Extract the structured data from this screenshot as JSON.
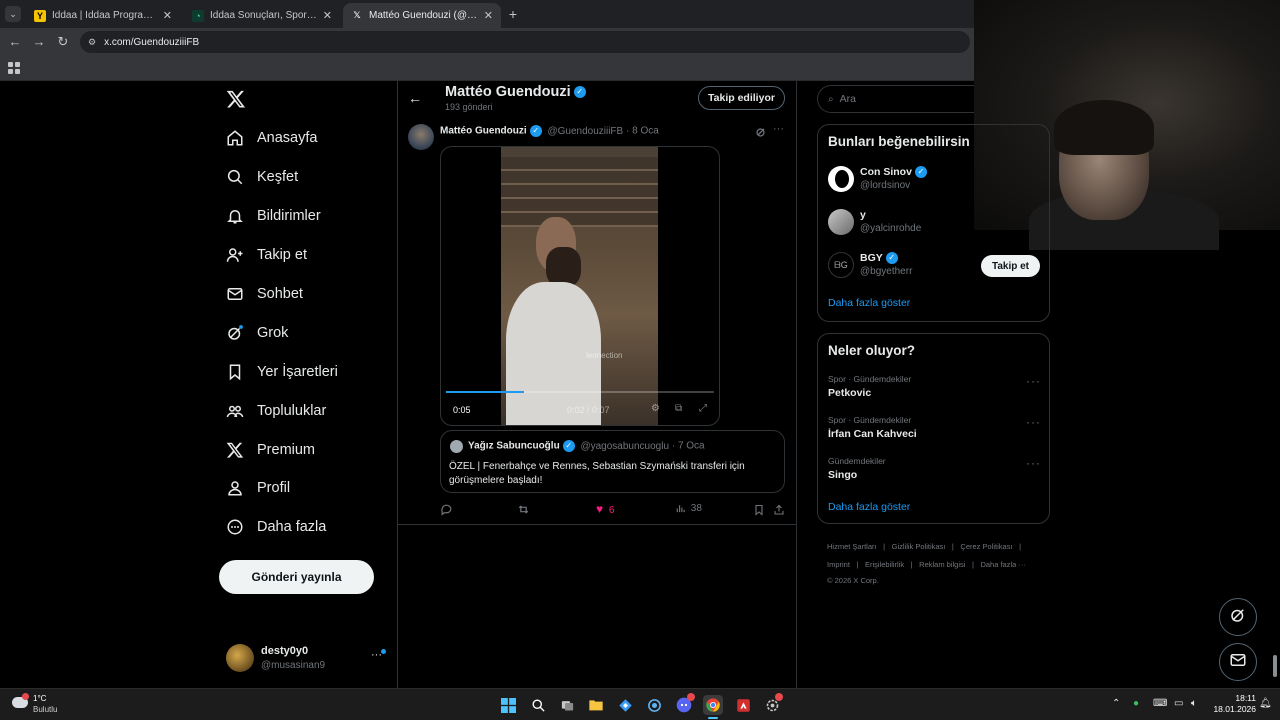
{
  "browser": {
    "tabs": [
      {
        "title": "İddaa | İddaa Programı | Canlı İ",
        "icon": "iddaa-favicon",
        "active": false
      },
      {
        "title": "İddaa Sonuçları, Spor Toto Süpe",
        "icon": "sonuclar-favicon",
        "active": false
      },
      {
        "title": "Mattéo Guendouzi (@Guen",
        "icon": "x-favicon",
        "active": true
      }
    ],
    "url": "x.com/GuendouziiiFB"
  },
  "sidebar": {
    "items": [
      {
        "label": "Anasayfa",
        "icon": "home-icon"
      },
      {
        "label": "Keşfet",
        "icon": "search-icon"
      },
      {
        "label": "Bildirimler",
        "icon": "bell-icon"
      },
      {
        "label": "Takip et",
        "icon": "follow-icon"
      },
      {
        "label": "Sohbet",
        "icon": "mail-icon"
      },
      {
        "label": "Grok",
        "icon": "grok-icon"
      },
      {
        "label": "Yer İşaretleri",
        "icon": "bookmark-icon"
      },
      {
        "label": "Topluluklar",
        "icon": "communities-icon"
      },
      {
        "label": "Premium",
        "icon": "x-logo-icon"
      },
      {
        "label": "Profil",
        "icon": "profile-icon"
      },
      {
        "label": "Daha fazla",
        "icon": "more-circle-icon"
      }
    ],
    "post_button": "Gönderi yayınla",
    "account": {
      "name": "desty0y0",
      "handle": "@musasinan9"
    }
  },
  "profile_header": {
    "name": "Mattéo Guendouzi",
    "post_count": "193 gönderi",
    "follow_button": "Takip ediliyor"
  },
  "post": {
    "author": "Mattéo Guendouzi",
    "handle": "@GuendouziiiFB",
    "date": "8 Oca",
    "video": {
      "elapsed": "0:05",
      "time_display": "0:02 / 0:07",
      "watermark": "leonection"
    },
    "quoted": {
      "author": "Yağız Sabuncuoğlu",
      "handle": "@yagosabuncuoglu",
      "date": "7 Oca",
      "text": "ÖZEL | Fenerbahçe ve Rennes, Sebastian Szymański transferi için görüşmelere başladı!"
    },
    "actions": {
      "likes": "6",
      "views": "38"
    }
  },
  "right": {
    "search_placeholder": "Ara",
    "suggestions": {
      "title": "Bunları beğenebilirsin",
      "accounts": [
        {
          "name": "Con Sinov",
          "handle": "@lordsinov",
          "verified": true
        },
        {
          "name": "y",
          "handle": "@yalcinrohde",
          "verified": false
        },
        {
          "name": "BGY",
          "handle": "@bgyetherr",
          "verified": true
        }
      ],
      "follow_label": "Takip et",
      "show_more": "Daha fazla göster"
    },
    "trends": {
      "title": "Neler oluyor?",
      "items": [
        {
          "meta": "Spor · Gündemdekiler",
          "name": "Petkovic"
        },
        {
          "meta": "Spor · Gündemdekiler",
          "name": "İrfan Can Kahveci"
        },
        {
          "meta": "Gündemdekiler",
          "name": "Singo"
        }
      ],
      "show_more": "Daha fazla göster"
    },
    "footer": {
      "links": [
        "Hizmet Şartları",
        "Gizlilik Politikası",
        "Çerez Politikası",
        "Imprint",
        "Erişilebilirlik",
        "Reklam bilgisi",
        "Daha fazla ···"
      ],
      "copyright": "© 2026 X Corp."
    }
  },
  "taskbar": {
    "weather_temp": "1°C",
    "weather_desc": "Bulutlu",
    "time": "18:11",
    "date": "18.01.2026"
  },
  "colors": {
    "accent": "#1d9bf0",
    "like": "#f91880",
    "background": "#000000"
  }
}
